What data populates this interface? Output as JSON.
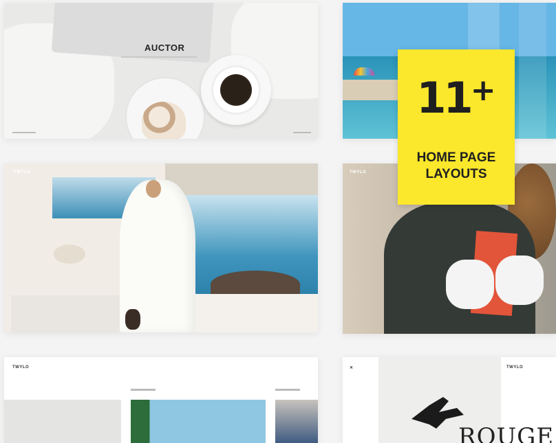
{
  "badge": {
    "number": "11",
    "plus": "+",
    "line1": "HOME PAGE",
    "line2": "LAYOUTS"
  },
  "card1": {
    "title": "AUCTOR"
  },
  "card3": {
    "logo": "TWYLO"
  },
  "card4": {
    "logo": "TWYLO"
  },
  "card5": {
    "logo": "TWYLO"
  },
  "card6": {
    "logo": "TWYLO",
    "word": "ROUGE"
  },
  "colors": {
    "badge": "#fbe72b",
    "badge_text": "#1f1f1f",
    "background": "#f4f4f4"
  }
}
